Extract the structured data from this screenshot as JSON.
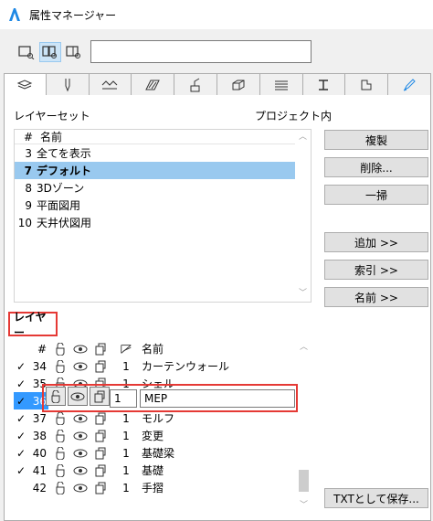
{
  "window": {
    "title": "属性マネージャー"
  },
  "search": {
    "value": ""
  },
  "tabs": [
    "layers-tab-icon",
    "pen-tab-icon",
    "line-type-tab-icon",
    "fill-tab-icon",
    "surface-tab-icon",
    "building-material-tab-icon",
    "composite-tab-icon",
    "profile-tab-icon",
    "zone-tab-icon",
    "markup-tab-icon"
  ],
  "layer_sets": {
    "label": "レイヤーセット",
    "scope": "プロジェクト内",
    "columns": {
      "num": "#",
      "name": "名前"
    },
    "rows": [
      {
        "num": "3",
        "name": "全てを表示"
      },
      {
        "num": "7",
        "name": "デフォルト",
        "selected": true
      },
      {
        "num": "8",
        "name": "3Dゾーン"
      },
      {
        "num": "9",
        "name": "平面図用"
      },
      {
        "num": "10",
        "name": "天井伏図用"
      }
    ]
  },
  "buttons": {
    "duplicate": "複製",
    "delete": "削除...",
    "purge": "一掃",
    "add": "追加 >>",
    "index": "索引 >>",
    "name": "名前 >>",
    "save_txt": "TXTとして保存..."
  },
  "layers": {
    "label": "レイヤー",
    "columns": {
      "num": "#",
      "name": "名前"
    },
    "rows": [
      {
        "checked": true,
        "num": "34",
        "pen": "1",
        "name": "カーテンウォール"
      },
      {
        "checked": true,
        "num": "35",
        "pen": "1",
        "name": "シェル"
      },
      {
        "checked": true,
        "num": "36",
        "pen": "1",
        "name": "MEP",
        "selected": true
      },
      {
        "checked": true,
        "num": "37",
        "pen": "1",
        "name": "モルフ"
      },
      {
        "checked": true,
        "num": "38",
        "pen": "1",
        "name": "変更"
      },
      {
        "checked": true,
        "num": "40",
        "pen": "1",
        "name": "基礎梁"
      },
      {
        "checked": true,
        "num": "41",
        "pen": "1",
        "name": "基礎"
      },
      {
        "checked": false,
        "num": "42",
        "pen": "1",
        "name": "手摺"
      }
    ]
  },
  "colors": {
    "selection": "#99c9ef",
    "highlight": "#3399ff",
    "annotation": "#e53935"
  }
}
